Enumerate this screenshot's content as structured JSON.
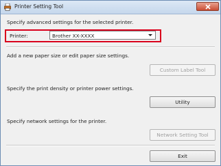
{
  "window": {
    "title": "Printer Setting Tool"
  },
  "main": {
    "intro": "Specify advanced settings for the selected printer.",
    "printer_label": "Printer:",
    "printer_value": "Brother XX-XXXX",
    "paper_text": "Add a new paper size or edit paper size settings.",
    "custom_label_button": "Custom Label Tool",
    "density_text": "Specify the print density or printer power settings.",
    "utility_button": "Utility",
    "network_text": "Specify network settings for the printer.",
    "network_button": "Network Setting Tool",
    "exit_button": "Exit"
  },
  "colors": {
    "highlight": "#d9001c",
    "close_button": "#c94d33"
  },
  "icons": {
    "app": "printer-icon",
    "close": "close-icon"
  }
}
